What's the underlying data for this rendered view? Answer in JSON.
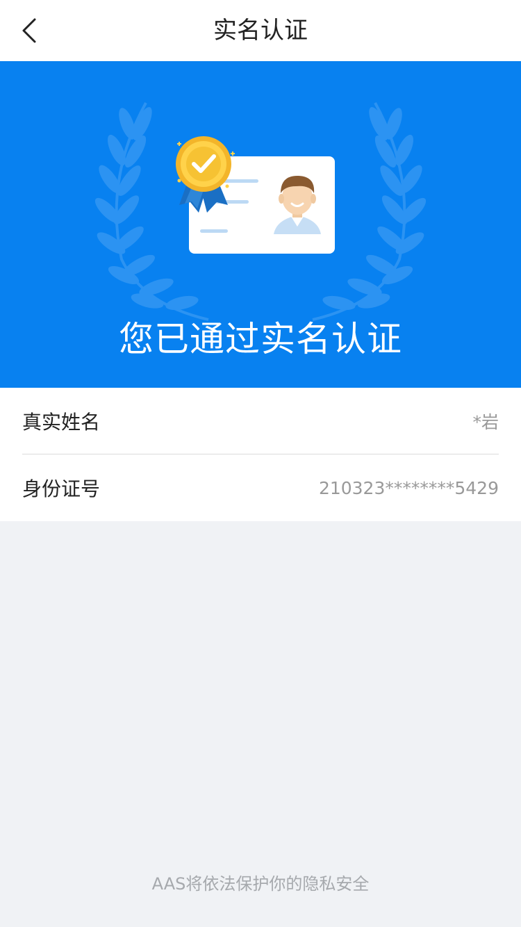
{
  "nav": {
    "back_icon": "chevron-left-icon",
    "title": "实名认证"
  },
  "banner": {
    "background_color": "#0881f0",
    "illustration": "verified-id-card-illustration",
    "headline": "您已通过实名认证"
  },
  "info": {
    "rows": [
      {
        "label": "真实姓名",
        "value": "*岩"
      },
      {
        "label": "身份证号",
        "value": "210323********5429"
      }
    ]
  },
  "footer": {
    "text": "AAS将依法保护你的隐私安全"
  }
}
